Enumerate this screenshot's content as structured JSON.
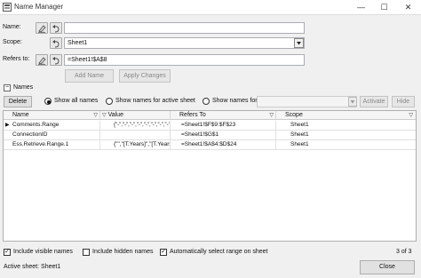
{
  "window": {
    "title": "Name Manager",
    "minimize": "—",
    "maximize": "☐",
    "close": "✕"
  },
  "form": {
    "name_label": "Name:",
    "name_value": "",
    "scope_label": "Scope:",
    "scope_value": "Sheet1",
    "refers_label": "Refers to:",
    "refers_value": "=Sheet1!$A$8",
    "add_name": "Add Name",
    "apply_changes": "Apply Changes"
  },
  "names_section": {
    "toggle": "−",
    "title": "Names"
  },
  "filter_bar": {
    "delete": "Delete",
    "show_all": "Show all names",
    "show_active": "Show names for active sheet",
    "show_for": "Show names for:",
    "show_for_value": "",
    "activate": "Activate",
    "hide": "Hide"
  },
  "table": {
    "columns": [
      "Name",
      "Value",
      "Refers To",
      "Scope"
    ],
    "rows": [
      {
        "name": "Comments.Range",
        "value": "{\"-\",\"-\",\"-\",\"-\",\"-\",\"-\",\"-\",\"-\",\"-\",\"-\",\"-\",\"-\",\"-\",\"-\",\"-\"}",
        "refers": "=Sheet1!$F$9:$F$23",
        "scope": "Sheet1",
        "current": true
      },
      {
        "name": "ConnectionID",
        "value": "",
        "refers": "=Sheet1!$G$1",
        "scope": "Sheet1",
        "current": false
      },
      {
        "name": "Ess.Retrieve.Range.1",
        "value": "{\"\",\"[T.Years]\",\"[T.Years...",
        "refers": "=Sheet1!$A$4:$D$24",
        "scope": "Sheet1",
        "current": false
      }
    ]
  },
  "options": {
    "include_visible": "Include visible names",
    "include_visible_checked": true,
    "include_hidden": "Include hidden names",
    "include_hidden_checked": false,
    "auto_select": "Automatically select range on sheet",
    "auto_select_checked": true,
    "count": "3 of 3"
  },
  "status": {
    "active_sheet": "Active sheet:  Sheet1",
    "close": "Close"
  }
}
